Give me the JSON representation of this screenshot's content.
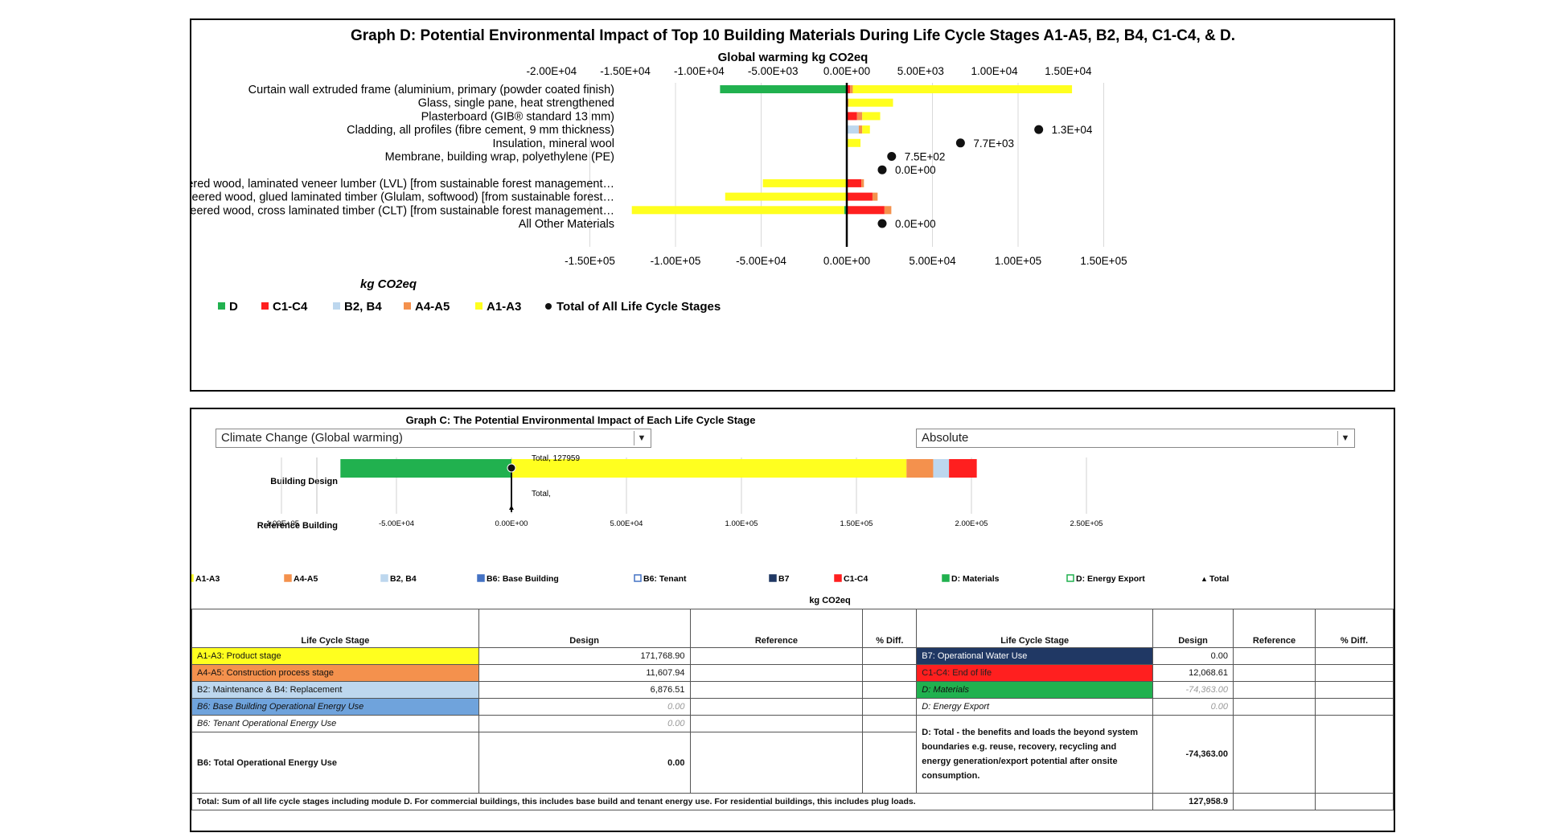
{
  "graph_d": {
    "title": "Graph D: Potential Environmental Impact of Top 10 Building Materials During Life Cycle Stages A1-A5, B2, B4, C1-C4, & D.",
    "top_axis_label": "Global warming kg CO2eq",
    "bottom_axis_label": "kg CO2eq",
    "top_ticks": [
      "-2.00E+04",
      "-1.50E+04",
      "-1.00E+04",
      "-5.00E+03",
      "0.00E+00",
      "5.00E+03",
      "1.00E+04",
      "1.50E+04"
    ],
    "bottom_ticks": [
      "-1.50E+05",
      "-1.00E+05",
      "-5.00E+04",
      "0.00E+00",
      "5.00E+04",
      "1.00E+05",
      "1.50E+05"
    ],
    "legend": [
      "D",
      "C1-C4",
      "B2, B4",
      "A4-A5",
      "A1-A3",
      "Total of All Life Cycle Stages"
    ]
  },
  "chart_data": [
    {
      "type": "bar",
      "orientation": "horizontal-stacked",
      "title": "Graph D: Potential Environmental Impact of Top 10 Building Materials During Life Cycle Stages A1-A5, B2, B4, C1-C4, & D.",
      "xlabel": "kg CO2eq",
      "secondary_xlabel": "Global warming kg CO2eq",
      "xlim": [
        -150000,
        150000
      ],
      "secondary_xlim": [
        -20000,
        15000
      ],
      "categories": [
        "Curtain wall extruded frame (aluminium, primary (powder coated finish)",
        "Glass, single pane, heat strengthened",
        "Plasterboard (GIB® standard 13 mm)",
        "Cladding, all profiles (fibre cement, 9 mm thickness)",
        "Insulation, mineral wool",
        "Membrane, building wrap, polyethylene (PE)",
        "",
        "Engineered wood, laminated veneer lumber (LVL) [from sustainable forest management…",
        "Engineered wood, glued laminated timber (Glulam, softwood) [from sustainable forest…",
        "Engineered wood, cross laminated timber (CLT) [from sustainable forest management…",
        "All Other Materials"
      ],
      "series": [
        {
          "name": "D",
          "color": "#21b14f",
          "values": [
            -74000,
            0,
            0,
            0,
            0,
            0,
            0,
            0,
            0,
            -1500,
            0
          ]
        },
        {
          "name": "C1-C4",
          "color": "#ff1f1f",
          "values": [
            2000,
            0,
            6000,
            0,
            0,
            0,
            0,
            8500,
            15000,
            22000,
            0
          ]
        },
        {
          "name": "B2, B4",
          "color": "#bdd7ee",
          "values": [
            0,
            0,
            0,
            7000,
            0,
            0,
            0,
            0,
            0,
            0,
            0
          ]
        },
        {
          "name": "A4-A5",
          "color": "#f4914d",
          "values": [
            1500,
            1000,
            3000,
            2000,
            0,
            0,
            0,
            1500,
            3000,
            4000,
            0
          ]
        },
        {
          "name": "A1-A3",
          "color": "#ffff1f",
          "values": [
            128000,
            26000,
            10500,
            4500,
            8000,
            0,
            0,
            -49000,
            -71000,
            -124000,
            0
          ]
        }
      ],
      "totals": {
        "name": "Total of All Life Cycle Stages",
        "values": [
          null,
          null,
          null,
          13000,
          7700,
          750,
          0,
          null,
          null,
          null,
          0
        ],
        "labels": [
          "",
          "",
          "",
          "1.3E+04",
          "7.7E+03",
          "7.5E+02",
          "0.0E+00",
          "",
          "",
          "",
          "0.0E+00"
        ]
      },
      "legend_position": "bottom-left",
      "grid": true
    },
    {
      "type": "bar",
      "orientation": "horizontal-stacked",
      "title": "Graph C: The Potential Environmental Impact of Each Life Cycle Stage",
      "xlabel": "kg CO2eq",
      "xlim": [
        -100000,
        250000
      ],
      "categories": [
        "Building Design",
        "Reference Building"
      ],
      "series": [
        {
          "name": "D: Materials",
          "color": "#21b14f",
          "values": [
            -74363,
            0
          ]
        },
        {
          "name": "A1-A3",
          "color": "#ffff1f",
          "values": [
            171768.9,
            0
          ]
        },
        {
          "name": "A4-A5",
          "color": "#f4914d",
          "values": [
            11607.94,
            0
          ]
        },
        {
          "name": "B2, B4",
          "color": "#bdd7ee",
          "values": [
            6876.51,
            0
          ]
        },
        {
          "name": "C1-C4",
          "color": "#ff1f1f",
          "values": [
            12068.61,
            0
          ]
        }
      ],
      "totals": {
        "name": "Total",
        "values": [
          127959,
          null
        ],
        "labels": [
          "Total, 127959",
          "Total,"
        ]
      },
      "legend_position": "bottom",
      "grid": true
    }
  ],
  "graph_c": {
    "title": "Graph C: The Potential Environmental Impact of Each Life Cycle Stage",
    "dropdown_impact": "Climate Change (Global warming)",
    "dropdown_mode": "Absolute",
    "ticks": [
      "-1.00E+05",
      "-5.00E+04",
      "0.00E+00",
      "5.00E+04",
      "1.00E+05",
      "1.50E+05",
      "2.00E+05",
      "2.50E+05"
    ],
    "xlabel": "kg CO2eq",
    "total_design_label": "Total, 127959",
    "total_reference_label": "Total,",
    "legend": [
      {
        "label": "A1-A3",
        "color": "#ffff1f"
      },
      {
        "label": "A4-A5",
        "color": "#f4914d"
      },
      {
        "label": "B2, B4",
        "color": "#bdd7ee"
      },
      {
        "label": "B6: Base Building",
        "color": "#4472c4"
      },
      {
        "label": "B6: Tenant",
        "color": "#ffffff",
        "border": "#4472c4"
      },
      {
        "label": "B7",
        "color": "#203864"
      },
      {
        "label": "C1-C4",
        "color": "#ff1f1f"
      },
      {
        "label": "D: Materials",
        "color": "#21b14f"
      },
      {
        "label": "D: Energy Export",
        "color": "#ffffff",
        "border": "#21b14f"
      },
      {
        "label": "Total",
        "marker": "▲"
      }
    ]
  },
  "table": {
    "headers": {
      "stage": "Life Cycle Stage",
      "design": "Design",
      "reference": "Reference",
      "diff": "% Diff.",
      "stage2": "Life Cycle Stage",
      "design2": "Design",
      "reference2": "Reference",
      "diff2": "% Diff."
    },
    "rows": [
      {
        "stage": "A1-A3: Product stage",
        "design": "171,768.90",
        "stage2": "B7: Operational Water Use",
        "design2": "0.00"
      },
      {
        "stage": "A4-A5: Construction process stage",
        "design": "11,607.94",
        "stage2": "C1-C4: End of life",
        "design2": "12,068.61"
      },
      {
        "stage": "B2: Maintenance & B4: Replacement",
        "design": "6,876.51",
        "stage2": "D: Materials",
        "design2": "-74,363.00"
      },
      {
        "stage": "B6: Base Building Operational Energy Use",
        "design": "0.00",
        "stage2": "D: Energy Export",
        "design2": "0.00"
      },
      {
        "stage": "B6: Tenant Operational Energy Use",
        "design": "0.00"
      }
    ],
    "b6_total_label": "B6: Total Operational Energy Use",
    "b6_total_value": "0.00",
    "d_total_label": "D: Total - the benefits and loads the beyond system boundaries e.g. reuse, recovery, recycling and energy generation/export potential after onsite consumption.",
    "d_total_value": "-74,363.00",
    "grand_total_label": "Total: Sum of all life cycle stages including module D.  For commercial buildings, this includes base build and tenant energy use.  For residential buildings, this includes plug loads.",
    "grand_total_value": "127,958.9"
  }
}
